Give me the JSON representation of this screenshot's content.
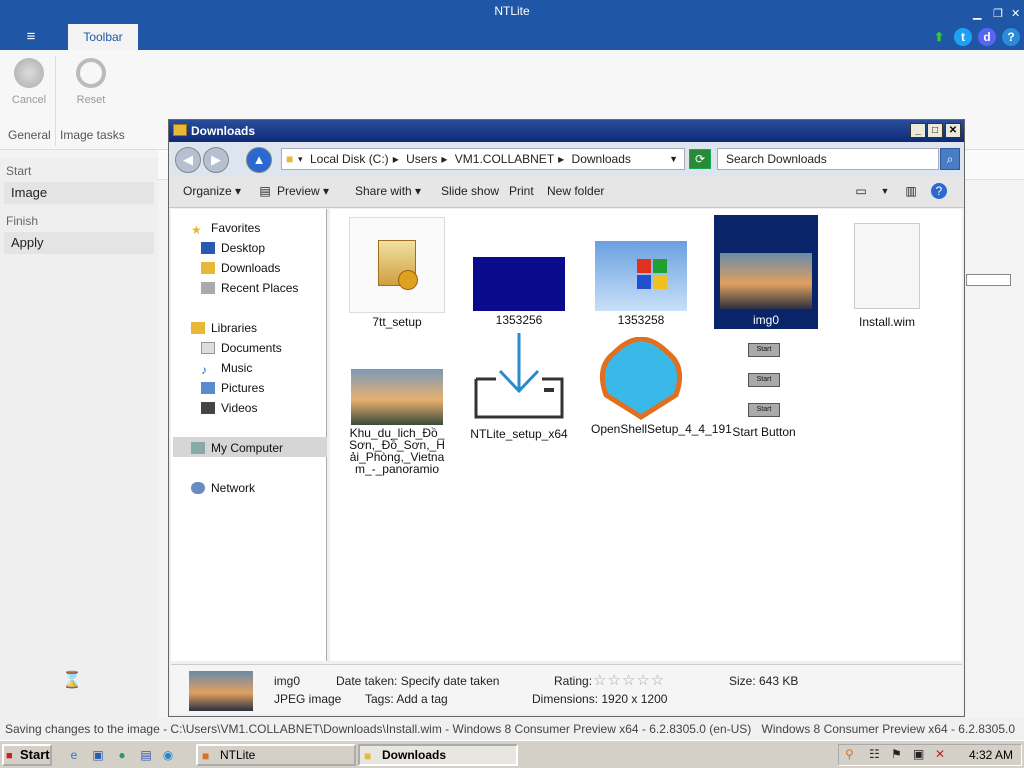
{
  "app": {
    "title": "NTLite"
  },
  "ribbon": {
    "tab": "Toolbar",
    "menu_icon": "≡",
    "cancel_label": "Cancel",
    "reset_label": "Reset",
    "group_general": "General",
    "group_image_tasks": "Image tasks"
  },
  "left_panel": {
    "start_section": "Start",
    "image_item": "Image",
    "finish_section": "Finish",
    "apply_item": "Apply"
  },
  "status": {
    "left": "Saving changes to the image - C:\\Users\\VM1.COLLABNET\\Downloads\\Install.wim - Windows 8 Consumer Preview x64 - 6.2.8305.0 (en-US)",
    "right": "Windows 8 Consumer Preview x64 - 6.2.8305.0"
  },
  "explorer": {
    "title": "Downloads",
    "breadcrumb": [
      "Local Disk (C:)",
      "Users",
      "VM1.COLLABNET",
      "Downloads"
    ],
    "search_placeholder": "Search Downloads",
    "commands": {
      "organize": "Organize",
      "preview": "Preview",
      "share": "Share with",
      "slideshow": "Slide show",
      "print": "Print",
      "new_folder": "New folder"
    },
    "nav": {
      "favorites": "Favorites",
      "desktop": "Desktop",
      "downloads": "Downloads",
      "recent": "Recent Places",
      "libraries": "Libraries",
      "documents": "Documents",
      "music": "Music",
      "pictures": "Pictures",
      "videos": "Videos",
      "my_computer": "My Computer",
      "network": "Network"
    },
    "files": [
      {
        "name": "7tt_setup"
      },
      {
        "name": "1353256"
      },
      {
        "name": "1353258"
      },
      {
        "name": "img0"
      },
      {
        "name": "Install.wim"
      },
      {
        "name": "Khu_du_lich_Đồ_Sơn,_Đồ_Sơn,_Hải_Phòng,_Vietnam_-_panoramio"
      },
      {
        "name": "NTLite_setup_x64"
      },
      {
        "name": "OpenShellSetup_4_4_191"
      },
      {
        "name": "Start Button"
      }
    ],
    "details": {
      "name": "img0",
      "type": "JPEG image",
      "date_taken": "Date taken: Specify date taken",
      "tags": "Tags: Add a tag",
      "rating_label": "Rating:",
      "rating_stars": "☆☆☆☆☆",
      "dimensions": "Dimensions: 1920 x 1200",
      "size": "Size: 643 KB"
    }
  },
  "taskbar": {
    "start_label": "Start",
    "ntlite_btn": "NTLite",
    "downloads_btn": "Downloads",
    "clock": "4:32 AM"
  },
  "colors": {
    "ntlite_blue": "#1f57a6",
    "selection": "#0a246a"
  }
}
